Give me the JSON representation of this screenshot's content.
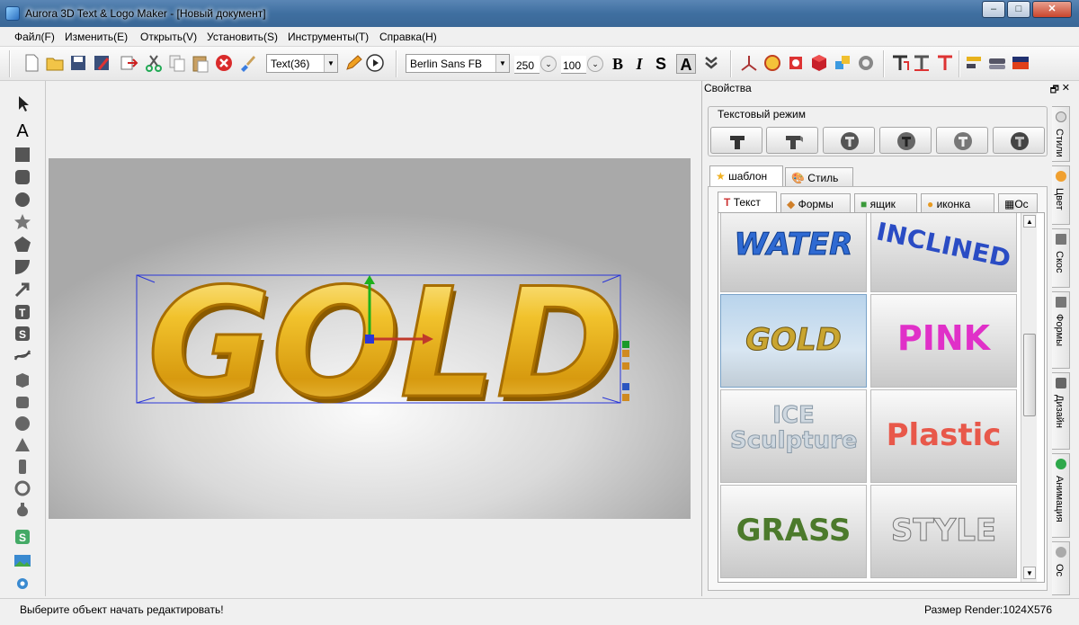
{
  "window": {
    "title": "Aurora 3D Text & Logo Maker - [Новый документ]",
    "minimize": "–",
    "maximize": "□",
    "close": "✕"
  },
  "menu": [
    "Файл(F)",
    "Изменить(E)",
    "Открыть(V)",
    "Установить(S)",
    "Инструменты(T)",
    "Справка(H)"
  ],
  "toolbar": {
    "object_select": "Text(36)",
    "font_select": "Berlin Sans FB",
    "font_size": "250",
    "depth": "100",
    "bold": "B",
    "italic": "I",
    "shadow": "S",
    "outline": "A"
  },
  "canvas": {
    "text": "GOLD"
  },
  "properties": {
    "title": "Свойства",
    "pin": "🗗",
    "close": "✕",
    "text_mode_label": "Текстовый режим",
    "outer_tabs": [
      "шаблон",
      "Стиль"
    ],
    "inner_tabs": [
      "Текст",
      "Формы",
      "ящик",
      "иконка",
      "Ос"
    ],
    "thumbnails": [
      "WATER",
      "INCLINED",
      "GOLD",
      "PINK",
      "ICE Sculpture",
      "Plastic",
      "GRASS",
      "STYLE"
    ],
    "side_tabs": [
      "Стили",
      "Цвет",
      "Скос",
      "Формы",
      "Дизайн",
      "Анимация",
      "Ос"
    ]
  },
  "status": {
    "message": "Выберите объект начать редактировать!",
    "render_size": "Размер Render:1024X576"
  },
  "colors": {
    "gold": "#e8b21c",
    "title_bar": "#4a78a8",
    "selection": "#2a36d8"
  }
}
